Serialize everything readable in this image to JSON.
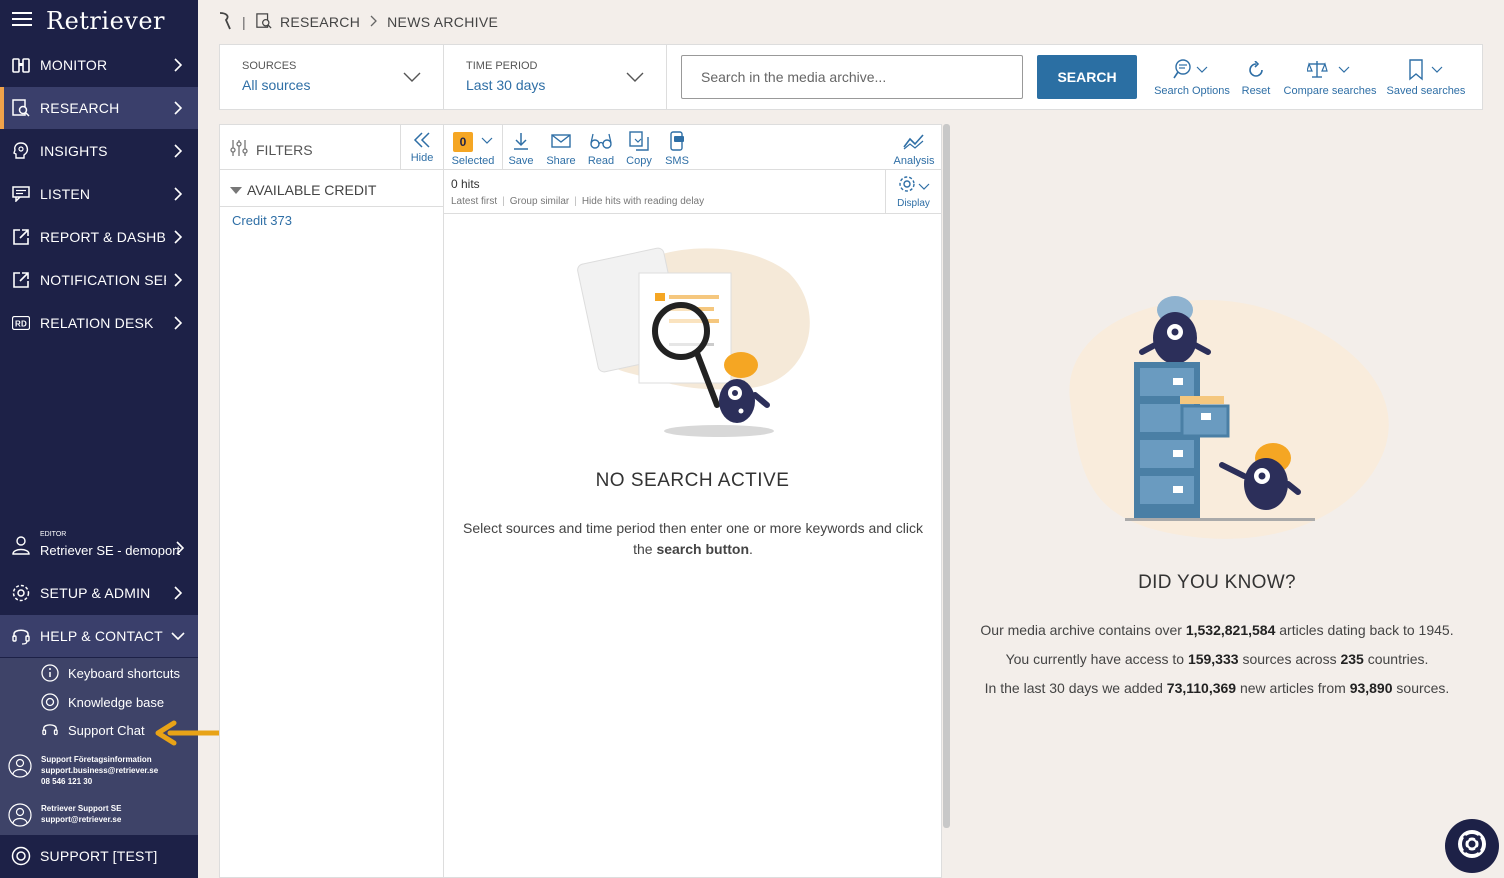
{
  "sidebar": {
    "logo": "Retriever",
    "items": [
      {
        "label": "MONITOR",
        "icon": "binoculars-icon"
      },
      {
        "label": "RESEARCH",
        "icon": "research-icon"
      },
      {
        "label": "INSIGHTS",
        "icon": "lightbulb-head-icon"
      },
      {
        "label": "LISTEN",
        "icon": "chat-icon"
      },
      {
        "label": "REPORT & DASHBOA…",
        "icon": "external-link-icon"
      },
      {
        "label": "NOTIFICATION SERV…",
        "icon": "external-link-icon"
      },
      {
        "label": "RELATION DESK",
        "icon": "rd-icon"
      }
    ],
    "editor": {
      "role": "EDITOR",
      "name": "Retriever SE - demoport"
    },
    "setup": "SETUP & ADMIN",
    "help": "HELP & CONTACT",
    "help_items": [
      "Keyboard shortcuts",
      "Knowledge base",
      "Support Chat"
    ],
    "support1": {
      "title": "Support Företagsinformation",
      "email": "support.business@retriever.se",
      "phone": "08 546 121 30"
    },
    "support2": {
      "title": "Retriever Support SE",
      "email": "support@retriever.se"
    },
    "support_test": "SUPPORT [TEST]"
  },
  "breadcrumb": {
    "section": "RESEARCH",
    "page": "NEWS ARCHIVE"
  },
  "search": {
    "sources_caption": "SOURCES",
    "sources_value": "All sources",
    "period_caption": "TIME PERIOD",
    "period_value": "Last 30 days",
    "placeholder": "Search in the media archive...",
    "button": "SEARCH",
    "tools": [
      "Search Options",
      "Reset",
      "Compare searches",
      "Saved searches"
    ]
  },
  "filters": {
    "title": "FILTERS",
    "hide": "Hide",
    "available_credit": "AVAILABLE CREDIT",
    "credit": "Credit 373"
  },
  "results": {
    "selected_count": "0",
    "toolbar": [
      "Selected",
      "Save",
      "Share",
      "Read",
      "Copy",
      "SMS",
      "Analysis"
    ],
    "hits": "0 hits",
    "options": [
      "Latest first",
      "Group similar",
      "Hide hits with reading delay"
    ],
    "display": "Display",
    "empty_title": "NO SEARCH ACTIVE",
    "empty_text_1": "Select sources and time period then enter one or more keywords and click the",
    "empty_text_bold": "search button",
    "empty_text_end": "."
  },
  "dyk": {
    "title": "DID YOU KNOW?",
    "l1a": "Our media archive contains over",
    "l1b": "1,532,821,584",
    "l1c": "articles dating back to 1945.",
    "l2a": "You currently have access to",
    "l2b": "159,333",
    "l2c": "sources across",
    "l2d": "235",
    "l2e": "countries.",
    "l3a": "In the last 30 days we added",
    "l3b": "73,110,369",
    "l3c": "new articles from",
    "l3d": "93,890",
    "l3e": "sources."
  },
  "colors": {
    "sidebar": "#1d2147",
    "accent": "#f5a623",
    "link": "#2f6fa6",
    "button": "#2b6fa3"
  }
}
